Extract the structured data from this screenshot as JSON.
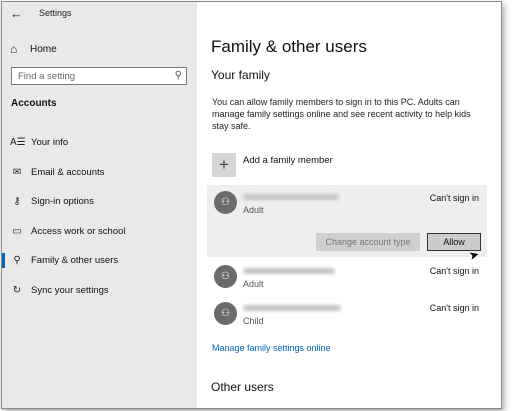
{
  "window": {
    "app_title": "Settings"
  },
  "sidebar": {
    "home_label": "Home",
    "search_placeholder": "Find a setting",
    "section_heading": "Accounts",
    "items": [
      {
        "label": "Your info",
        "icon": "person-card-icon",
        "glyph": "A☰"
      },
      {
        "label": "Email & accounts",
        "icon": "mail-icon",
        "glyph": "✉"
      },
      {
        "label": "Sign-in options",
        "icon": "key-icon",
        "glyph": "⚷"
      },
      {
        "label": "Access work or school",
        "icon": "briefcase-icon",
        "glyph": "▭"
      },
      {
        "label": "Family & other users",
        "icon": "person-add-icon",
        "glyph": "⚲"
      },
      {
        "label": "Sync your settings",
        "icon": "sync-icon",
        "glyph": "↻"
      }
    ],
    "active_index": 4
  },
  "main": {
    "title": "Family & other users",
    "your_family_heading": "Your family",
    "description": "You can allow family members to sign in to this PC. Adults can manage family settings online and see recent activity to help kids stay safe.",
    "add_member_label": "Add a family member",
    "members": [
      {
        "role": "Adult",
        "status": "Can't sign in",
        "selected": true
      },
      {
        "role": "Adult",
        "status": "Can't sign in",
        "selected": false
      },
      {
        "role": "Child",
        "status": "Can't sign in",
        "selected": false
      }
    ],
    "change_account_type_label": "Change account type",
    "allow_label": "Allow",
    "manage_link": "Manage family settings online",
    "other_users_heading": "Other users"
  },
  "colors": {
    "accent": "#0067c0",
    "sidebar_bg": "#e9e9e9",
    "avatar": "#6b6b6b"
  }
}
